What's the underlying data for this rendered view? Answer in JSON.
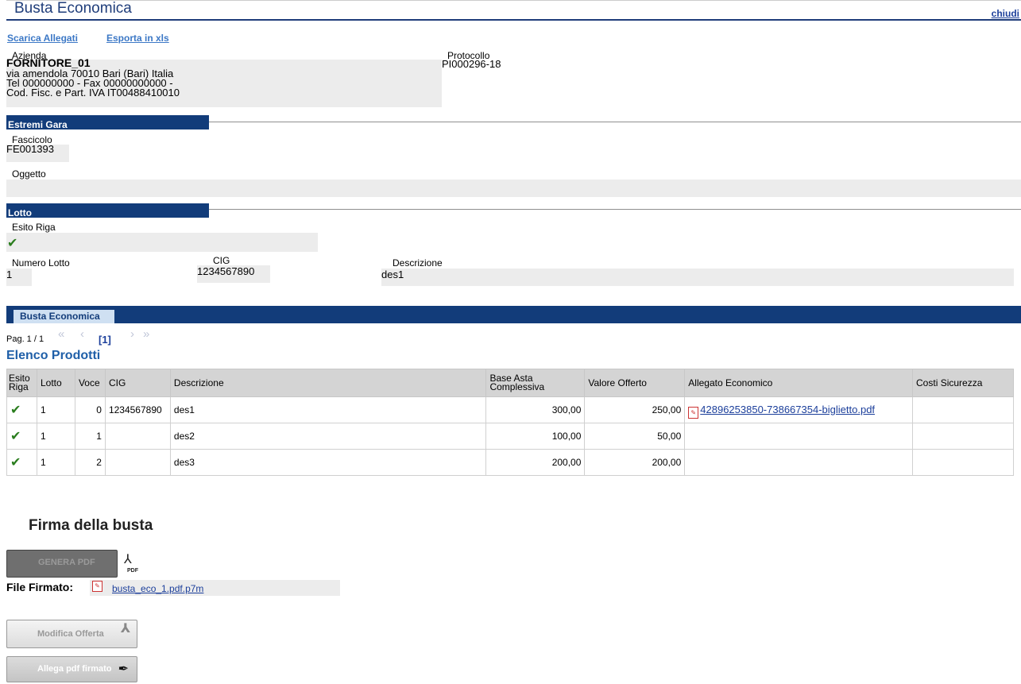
{
  "header": {
    "title": "Busta Economica",
    "close_label": "chiudi"
  },
  "toolbar": {
    "download_label": "Scarica Allegati",
    "export_label": "Esporta in xls"
  },
  "azienda": {
    "label": "Azienda",
    "name": "FORNITORE_01",
    "address": "via amendola 70010 Bari (Bari) Italia",
    "phone": "Tel 000000000 - Fax 00000000000 -",
    "fiscal": "Cod. Fisc. e Part. IVA IT00488410010"
  },
  "protocollo": {
    "label": "Protocollo",
    "value": "PI000296-18"
  },
  "estremi_gara": {
    "section_title": "Estremi Gara",
    "fascicolo_label": "Fascicolo",
    "fascicolo_value": "FE001393",
    "oggetto_label": "Oggetto",
    "oggetto_value": ""
  },
  "lotto": {
    "section_title": "Lotto",
    "esito_label": "Esito Riga",
    "numero_label": "Numero Lotto",
    "numero_value": "1",
    "cig_label": "CIG",
    "cig_value": "1234567890",
    "descrizione_label": "Descrizione",
    "descrizione_value": "des1"
  },
  "tab": {
    "label": "Busta Economica"
  },
  "pager": {
    "prefix": "Pag. 1 / 1",
    "current": "[1]"
  },
  "products": {
    "title": "Elenco Prodotti",
    "columns": [
      "Esito Riga",
      "Lotto",
      "Voce",
      "CIG",
      "Descrizione",
      "Base Asta Complessiva",
      "Valore Offerto",
      "Allegato Economico",
      "Costi Sicurezza"
    ],
    "rows": [
      {
        "lotto": "1",
        "voce": "0",
        "cig": "1234567890",
        "descrizione": "des1",
        "base": "300,00",
        "valore": "250,00",
        "allegato": "42896253850-738667354-biglietto.pdf",
        "costi": ""
      },
      {
        "lotto": "1",
        "voce": "1",
        "cig": "",
        "descrizione": "des2",
        "base": "100,00",
        "valore": "50,00",
        "allegato": "",
        "costi": ""
      },
      {
        "lotto": "1",
        "voce": "2",
        "cig": "",
        "descrizione": "des3",
        "base": "200,00",
        "valore": "200,00",
        "allegato": "",
        "costi": ""
      }
    ]
  },
  "firma": {
    "title": "Firma della busta",
    "genera_label": "GENERA PDF",
    "pdf_tag": "PDF",
    "file_label": "File Firmato:",
    "file_name": "busta_eco_1.pdf.p7m",
    "modifica_label": "Modifica Offerta",
    "allega_label": "Allega pdf firmato"
  },
  "colors": {
    "primary": "#123c7a",
    "link": "#1c3f9b",
    "check": "#2a7d1e"
  },
  "icons": [
    "check-icon",
    "pdf-icon",
    "pen-icon",
    "pager-first-icon",
    "pager-prev-icon",
    "pager-next-icon",
    "pager-last-icon"
  ]
}
